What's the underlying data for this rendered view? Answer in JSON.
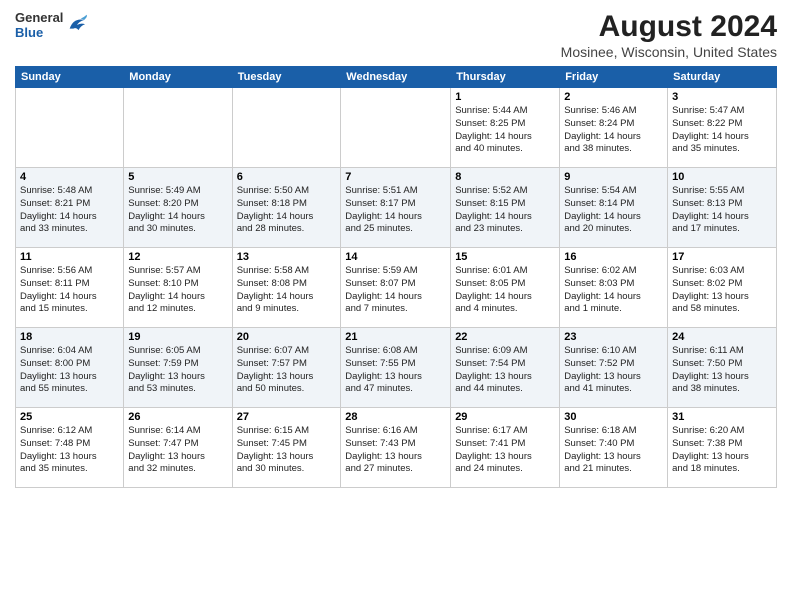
{
  "header": {
    "logo_general": "General",
    "logo_blue": "Blue",
    "main_title": "August 2024",
    "subtitle": "Mosinee, Wisconsin, United States"
  },
  "days_of_week": [
    "Sunday",
    "Monday",
    "Tuesday",
    "Wednesday",
    "Thursday",
    "Friday",
    "Saturday"
  ],
  "weeks": [
    [
      {
        "day": "",
        "info": ""
      },
      {
        "day": "",
        "info": ""
      },
      {
        "day": "",
        "info": ""
      },
      {
        "day": "",
        "info": ""
      },
      {
        "day": "1",
        "info": "Sunrise: 5:44 AM\nSunset: 8:25 PM\nDaylight: 14 hours\nand 40 minutes."
      },
      {
        "day": "2",
        "info": "Sunrise: 5:46 AM\nSunset: 8:24 PM\nDaylight: 14 hours\nand 38 minutes."
      },
      {
        "day": "3",
        "info": "Sunrise: 5:47 AM\nSunset: 8:22 PM\nDaylight: 14 hours\nand 35 minutes."
      }
    ],
    [
      {
        "day": "4",
        "info": "Sunrise: 5:48 AM\nSunset: 8:21 PM\nDaylight: 14 hours\nand 33 minutes."
      },
      {
        "day": "5",
        "info": "Sunrise: 5:49 AM\nSunset: 8:20 PM\nDaylight: 14 hours\nand 30 minutes."
      },
      {
        "day": "6",
        "info": "Sunrise: 5:50 AM\nSunset: 8:18 PM\nDaylight: 14 hours\nand 28 minutes."
      },
      {
        "day": "7",
        "info": "Sunrise: 5:51 AM\nSunset: 8:17 PM\nDaylight: 14 hours\nand 25 minutes."
      },
      {
        "day": "8",
        "info": "Sunrise: 5:52 AM\nSunset: 8:15 PM\nDaylight: 14 hours\nand 23 minutes."
      },
      {
        "day": "9",
        "info": "Sunrise: 5:54 AM\nSunset: 8:14 PM\nDaylight: 14 hours\nand 20 minutes."
      },
      {
        "day": "10",
        "info": "Sunrise: 5:55 AM\nSunset: 8:13 PM\nDaylight: 14 hours\nand 17 minutes."
      }
    ],
    [
      {
        "day": "11",
        "info": "Sunrise: 5:56 AM\nSunset: 8:11 PM\nDaylight: 14 hours\nand 15 minutes."
      },
      {
        "day": "12",
        "info": "Sunrise: 5:57 AM\nSunset: 8:10 PM\nDaylight: 14 hours\nand 12 minutes."
      },
      {
        "day": "13",
        "info": "Sunrise: 5:58 AM\nSunset: 8:08 PM\nDaylight: 14 hours\nand 9 minutes."
      },
      {
        "day": "14",
        "info": "Sunrise: 5:59 AM\nSunset: 8:07 PM\nDaylight: 14 hours\nand 7 minutes."
      },
      {
        "day": "15",
        "info": "Sunrise: 6:01 AM\nSunset: 8:05 PM\nDaylight: 14 hours\nand 4 minutes."
      },
      {
        "day": "16",
        "info": "Sunrise: 6:02 AM\nSunset: 8:03 PM\nDaylight: 14 hours\nand 1 minute."
      },
      {
        "day": "17",
        "info": "Sunrise: 6:03 AM\nSunset: 8:02 PM\nDaylight: 13 hours\nand 58 minutes."
      }
    ],
    [
      {
        "day": "18",
        "info": "Sunrise: 6:04 AM\nSunset: 8:00 PM\nDaylight: 13 hours\nand 55 minutes."
      },
      {
        "day": "19",
        "info": "Sunrise: 6:05 AM\nSunset: 7:59 PM\nDaylight: 13 hours\nand 53 minutes."
      },
      {
        "day": "20",
        "info": "Sunrise: 6:07 AM\nSunset: 7:57 PM\nDaylight: 13 hours\nand 50 minutes."
      },
      {
        "day": "21",
        "info": "Sunrise: 6:08 AM\nSunset: 7:55 PM\nDaylight: 13 hours\nand 47 minutes."
      },
      {
        "day": "22",
        "info": "Sunrise: 6:09 AM\nSunset: 7:54 PM\nDaylight: 13 hours\nand 44 minutes."
      },
      {
        "day": "23",
        "info": "Sunrise: 6:10 AM\nSunset: 7:52 PM\nDaylight: 13 hours\nand 41 minutes."
      },
      {
        "day": "24",
        "info": "Sunrise: 6:11 AM\nSunset: 7:50 PM\nDaylight: 13 hours\nand 38 minutes."
      }
    ],
    [
      {
        "day": "25",
        "info": "Sunrise: 6:12 AM\nSunset: 7:48 PM\nDaylight: 13 hours\nand 35 minutes."
      },
      {
        "day": "26",
        "info": "Sunrise: 6:14 AM\nSunset: 7:47 PM\nDaylight: 13 hours\nand 32 minutes."
      },
      {
        "day": "27",
        "info": "Sunrise: 6:15 AM\nSunset: 7:45 PM\nDaylight: 13 hours\nand 30 minutes."
      },
      {
        "day": "28",
        "info": "Sunrise: 6:16 AM\nSunset: 7:43 PM\nDaylight: 13 hours\nand 27 minutes."
      },
      {
        "day": "29",
        "info": "Sunrise: 6:17 AM\nSunset: 7:41 PM\nDaylight: 13 hours\nand 24 minutes."
      },
      {
        "day": "30",
        "info": "Sunrise: 6:18 AM\nSunset: 7:40 PM\nDaylight: 13 hours\nand 21 minutes."
      },
      {
        "day": "31",
        "info": "Sunrise: 6:20 AM\nSunset: 7:38 PM\nDaylight: 13 hours\nand 18 minutes."
      }
    ]
  ]
}
